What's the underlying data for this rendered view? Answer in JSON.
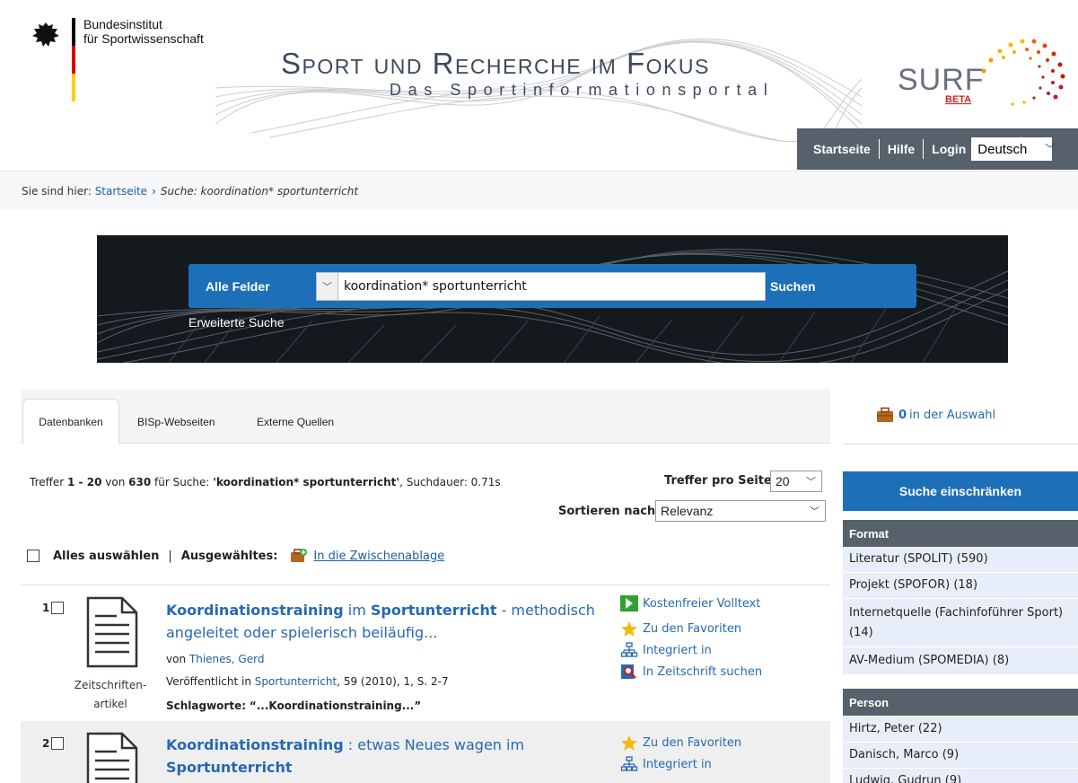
{
  "header": {
    "institute_line1": "Bundesinstitut",
    "institute_line2": "für Sportwissenschaft",
    "site_title": "Sport und Recherche im Fokus",
    "site_subtitle": "Das Sportinformationsportal",
    "logo_text": "SURF",
    "logo_badge": "BETA",
    "nav": {
      "home": "Startseite",
      "help": "Hilfe",
      "login": "Login",
      "language": "Deutsch"
    }
  },
  "breadcrumb": {
    "prefix": "Sie sind hier:",
    "home": "Startseite",
    "current": "Suche: koordination* sportunterricht"
  },
  "search": {
    "field": "Alle Felder",
    "query": "koordination* sportunterricht",
    "button": "Suchen",
    "advanced": "Erweiterte Suche"
  },
  "tabs": [
    "Datenbanken",
    "BISp-Webseiten",
    "Externe Quellen"
  ],
  "results_info": {
    "prefix": "Treffer",
    "range": "1 - 20",
    "von": "von",
    "total": "630",
    "fuer": "für Suche:",
    "query": "'koordination* sportunterricht'",
    "duration": ", Suchdauer: 0.71s",
    "per_page_label": "Treffer pro Seite",
    "per_page_value": "20",
    "sort_label": "Sortieren nach",
    "sort_value": "Relevanz"
  },
  "selection_bar": {
    "select_all": "Alles auswählen",
    "separator": "|",
    "selected": "Ausgewähltes:",
    "clipboard": "In die Zwischenablage"
  },
  "results": [
    {
      "num": "1",
      "type_line1": "Zeitschriften-",
      "type_line2": "artikel",
      "title_hl1": "Koordinationstraining",
      "title_mid": " im ",
      "title_hl2": "Sportunterricht",
      "title_rest": " - methodisch angeleitet oder spielerisch beiläufig...",
      "von": "von",
      "author": "Thienes, Gerd",
      "published_prefix": "Veröffentlicht in",
      "journal": "Sportunterricht",
      "published_rest": ", 59 (2010), 1, S. 2-7",
      "keywords_label": "Schlagworte:",
      "keywords": "“...Koordinationstraining...”",
      "actions": [
        "Kostenfreier Volltext",
        "Zu den Favoriten",
        "Integriert in",
        "In Zeitschrift suchen"
      ]
    },
    {
      "num": "2",
      "title_hl1": "Koordinationstraining",
      "title_mid": " : etwas Neues wagen im ",
      "title_hl2": "Sportunterricht",
      "actions": [
        "Zu den Favoriten",
        "Integriert in"
      ]
    }
  ],
  "sidebar": {
    "selection_count": "0",
    "selection_label": "in der Auswahl",
    "refine": "Suche einschränken",
    "format_head": "Format",
    "format_items": [
      "Literatur (SPOLIT) (590)",
      "Projekt (SPOFOR) (18)",
      "Internetquelle (Fachinfoführer Sport) (14)",
      "AV-Medium (SPOMEDIA) (8)"
    ],
    "person_head": "Person",
    "person_items": [
      "Hirtz, Peter (22)",
      "Danisch, Marco (9)",
      "Ludwig, Gudrun (9)"
    ]
  },
  "colors": {
    "accent_blue": "#1d6fb8",
    "nav_gray": "#56616b",
    "link_blue": "#2569b5",
    "facet_bg": "#e8eef9"
  }
}
